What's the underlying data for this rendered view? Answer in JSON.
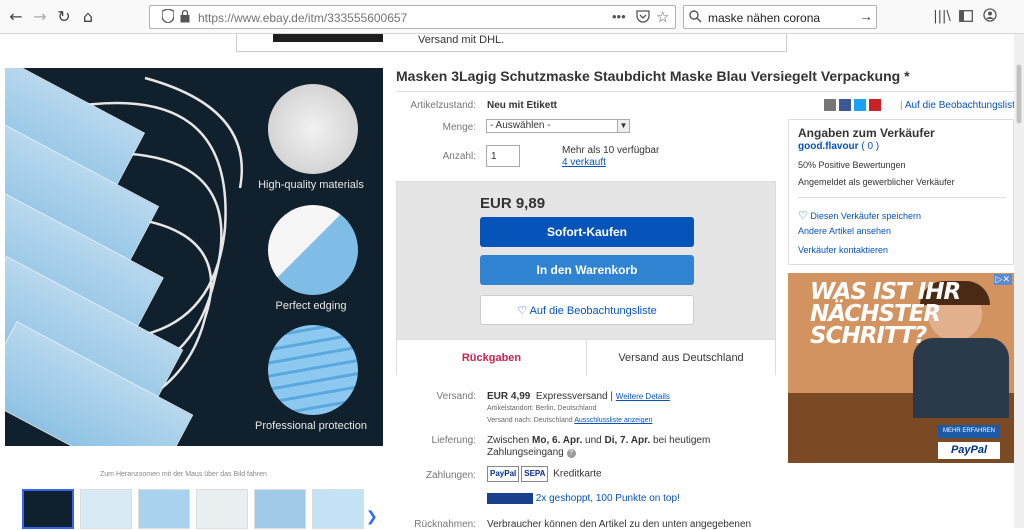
{
  "browser": {
    "url": "https://www.ebay.de/itm/333555600657",
    "search_query": "maske nähen corona",
    "icons": [
      "back-icon",
      "forward-icon",
      "reload-icon",
      "home-icon",
      "shield-icon",
      "lock-icon",
      "more-icon",
      "pocket-icon",
      "bookmark-star-icon",
      "search-icon",
      "go-arrow-icon",
      "library-icon",
      "sidebar-icon",
      "account-icon"
    ]
  },
  "top_strip": {
    "text": "Versand mit DHL."
  },
  "gallery": {
    "captions": [
      "High-quality materials",
      "Perfect edging",
      "Professional protection"
    ],
    "zoom_hint": "Zum Heranzoomen mit der Maus über das Bild fahren"
  },
  "product": {
    "title": "Masken 3Lagig Schutzmaske Staubdicht Maske Blau Versiegelt Verpackung *",
    "condition_label": "Artikelzustand:",
    "condition_value": "Neu mit Etikett",
    "watch_link": "Auf die Beobachtungsliste",
    "menge_label": "Menge:",
    "menge_value": "- Auswählen -",
    "anzahl_label": "Anzahl:",
    "anzahl_value": "1",
    "available": "Mehr als 10 verfügbar",
    "sold": "4 verkauft"
  },
  "buybox": {
    "price": "EUR 9,89",
    "buy_now": "Sofort-Kaufen",
    "add_to_cart": "In den Warenkorb",
    "watch": "Auf die Beobachtungsliste",
    "returns": "Rückgaben",
    "ships_from": "Versand aus Deutschland"
  },
  "shipping": {
    "label": "Versand:",
    "cost": "EUR 4,99",
    "method": "Expressversand",
    "more": "Weitere Details",
    "location": "Artikelstandort: Berlin, Deutschland",
    "ships_to_prefix": "Versand nach:",
    "ships_to": "Deutschland",
    "exclusions": "Ausschlussliste anzeigen",
    "delivery_label": "Lieferung:",
    "delivery_prefix": "Zwischen",
    "delivery_from": "Mo, 6. Apr.",
    "delivery_and": "und",
    "delivery_to": "Di, 7. Apr.",
    "delivery_suffix": "bei heutigem",
    "delivery_line2": "Zahlungseingang",
    "payments_label": "Zahlungen:",
    "payment_paypal": "PayPal",
    "payment_sepa": "SEPA",
    "payment_card": "Kreditkarte",
    "points": "2x geshoppt, 100 Punkte on top!",
    "returns_label": "Rücknahmen:",
    "returns_text": "Verbraucher können den Artikel zu den unten angegebenen"
  },
  "seller": {
    "heading": "Angaben zum Verkäufer",
    "name": "good.flavour",
    "score": "( 0 )",
    "positive": "50% Positive Bewertungen",
    "registered": "Angemeldet als gewerblicher Verkäufer",
    "save": "Diesen Verkäufer speichern",
    "other_items": "Andere Artikel ansehen",
    "contact": "Verkäufer kontaktieren"
  },
  "ad": {
    "headline": [
      "WAS IST IHR",
      "NÄCHSTER",
      "SCHRITT?"
    ],
    "cta": "MEHR ERFAHREN",
    "brand": "PayPal"
  }
}
